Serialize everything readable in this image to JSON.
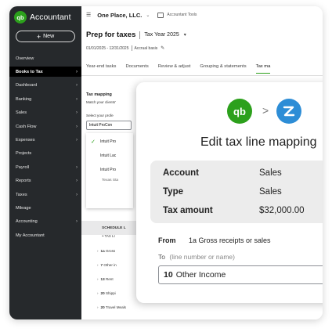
{
  "sidebar": {
    "brand": "Accountant",
    "logo_text": "qb",
    "new_button": "New",
    "items": [
      {
        "label": "Overview",
        "chevron": false,
        "active": false
      },
      {
        "label": "Books to Tax",
        "chevron": true,
        "active": true
      },
      {
        "label": "Dashboard",
        "chevron": true,
        "active": false
      },
      {
        "label": "Banking",
        "chevron": true,
        "active": false
      },
      {
        "label": "Sales",
        "chevron": true,
        "active": false
      },
      {
        "label": "Cash Flow",
        "chevron": true,
        "active": false
      },
      {
        "label": "Expenses",
        "chevron": true,
        "active": false
      },
      {
        "label": "Projects",
        "chevron": false,
        "active": false
      },
      {
        "label": "Payroll",
        "chevron": true,
        "active": false
      },
      {
        "label": "Reports",
        "chevron": true,
        "active": false
      },
      {
        "label": "Taxes",
        "chevron": true,
        "active": false
      },
      {
        "label": "Mileage",
        "chevron": false,
        "active": false
      },
      {
        "label": "Accounting",
        "chevron": true,
        "active": false
      },
      {
        "label": "My Accountant",
        "chevron": false,
        "active": false
      }
    ]
  },
  "topbar": {
    "company": "One Place, LLC.",
    "tools_label": "Accountant Tools"
  },
  "page": {
    "title": "Prep for taxes",
    "tax_year": "Tax Year 2025",
    "date_range": "01/01/2025 - 12/31/2025",
    "basis": "Accrual basis"
  },
  "tabs": [
    "Year-end tasks",
    "Documents",
    "Review & adjust",
    "Grouping & statements",
    "Tax ma"
  ],
  "background": {
    "tax_mapping_label": "Tax mapping",
    "tax_mapping_sub": "Match your clients'",
    "select_label": "Select your profe",
    "select_value": "Intuit ProCon",
    "options": [
      "Intuit Pro",
      "Intuit Lac",
      "Intuit Pro"
    ],
    "option_texas": "Texas Sta",
    "tax_line_header": "TAX LI",
    "lines": [
      {
        "num": "1a",
        "text": "Gross"
      },
      {
        "num": "7",
        "text": "Other in"
      },
      {
        "num": "13",
        "text": "Rent"
      },
      {
        "num": "20",
        "text": "Shippi"
      },
      {
        "num": "20",
        "text": "Travel Meals"
      }
    ],
    "schedule": "SCHEDULE L"
  },
  "modal": {
    "qb_logo": "qb",
    "arrow": ">",
    "title": "Edit tax line mapping",
    "summary": [
      {
        "key": "Account",
        "value": "Sales"
      },
      {
        "key": "Type",
        "value": "Sales"
      },
      {
        "key": "Tax amount",
        "value": "$32,000.00"
      }
    ],
    "from_label": "From",
    "from_value": "1a Gross receipts or sales",
    "to_label": "To",
    "to_hint": "(line number or name)",
    "to_value_num": "10",
    "to_value_text": "Other Income"
  },
  "colors": {
    "sidebar_bg": "#26292c",
    "brand_green": "#2ca01c",
    "partner_blue": "#2d8dd6"
  }
}
